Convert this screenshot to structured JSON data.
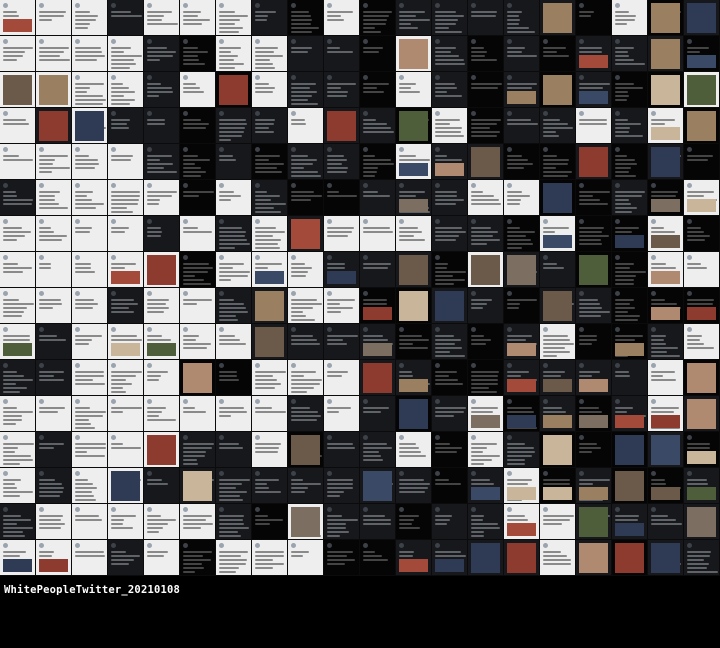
{
  "caption": "WhitePeopleTwitter_20210108",
  "colors": {
    "background": "#000000",
    "caption_text": "#ffffff",
    "tweet_light": "#eeeeee",
    "tweet_dark": "#16181c",
    "tweet_black": "#050505"
  }
}
